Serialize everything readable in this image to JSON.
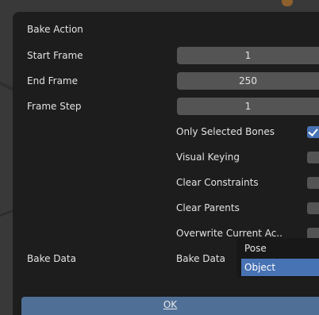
{
  "panel": {
    "title": "Bake Action",
    "start_frame": {
      "label": "Start Frame",
      "value": "1"
    },
    "end_frame": {
      "label": "End Frame",
      "value": "250"
    },
    "frame_step": {
      "label": "Frame Step",
      "value": "1"
    },
    "options": [
      {
        "label": "Only Selected Bones",
        "checked": true
      },
      {
        "label": "Visual Keying",
        "checked": false
      },
      {
        "label": "Clear Constraints",
        "checked": false
      },
      {
        "label": "Clear Parents",
        "checked": false
      },
      {
        "label": "Overwrite Current Ac..",
        "checked": false
      }
    ],
    "bake_data": {
      "row_label": "Bake Data",
      "field_label": "Bake Data",
      "options": [
        "Pose",
        "Object"
      ],
      "highlighted": "Object"
    },
    "ok_label": "OK"
  },
  "colors": {
    "panel_bg": "#1d1d1d",
    "field_bg": "#545454",
    "accent": "#4772b3",
    "ok_button": "#4f6f96"
  }
}
